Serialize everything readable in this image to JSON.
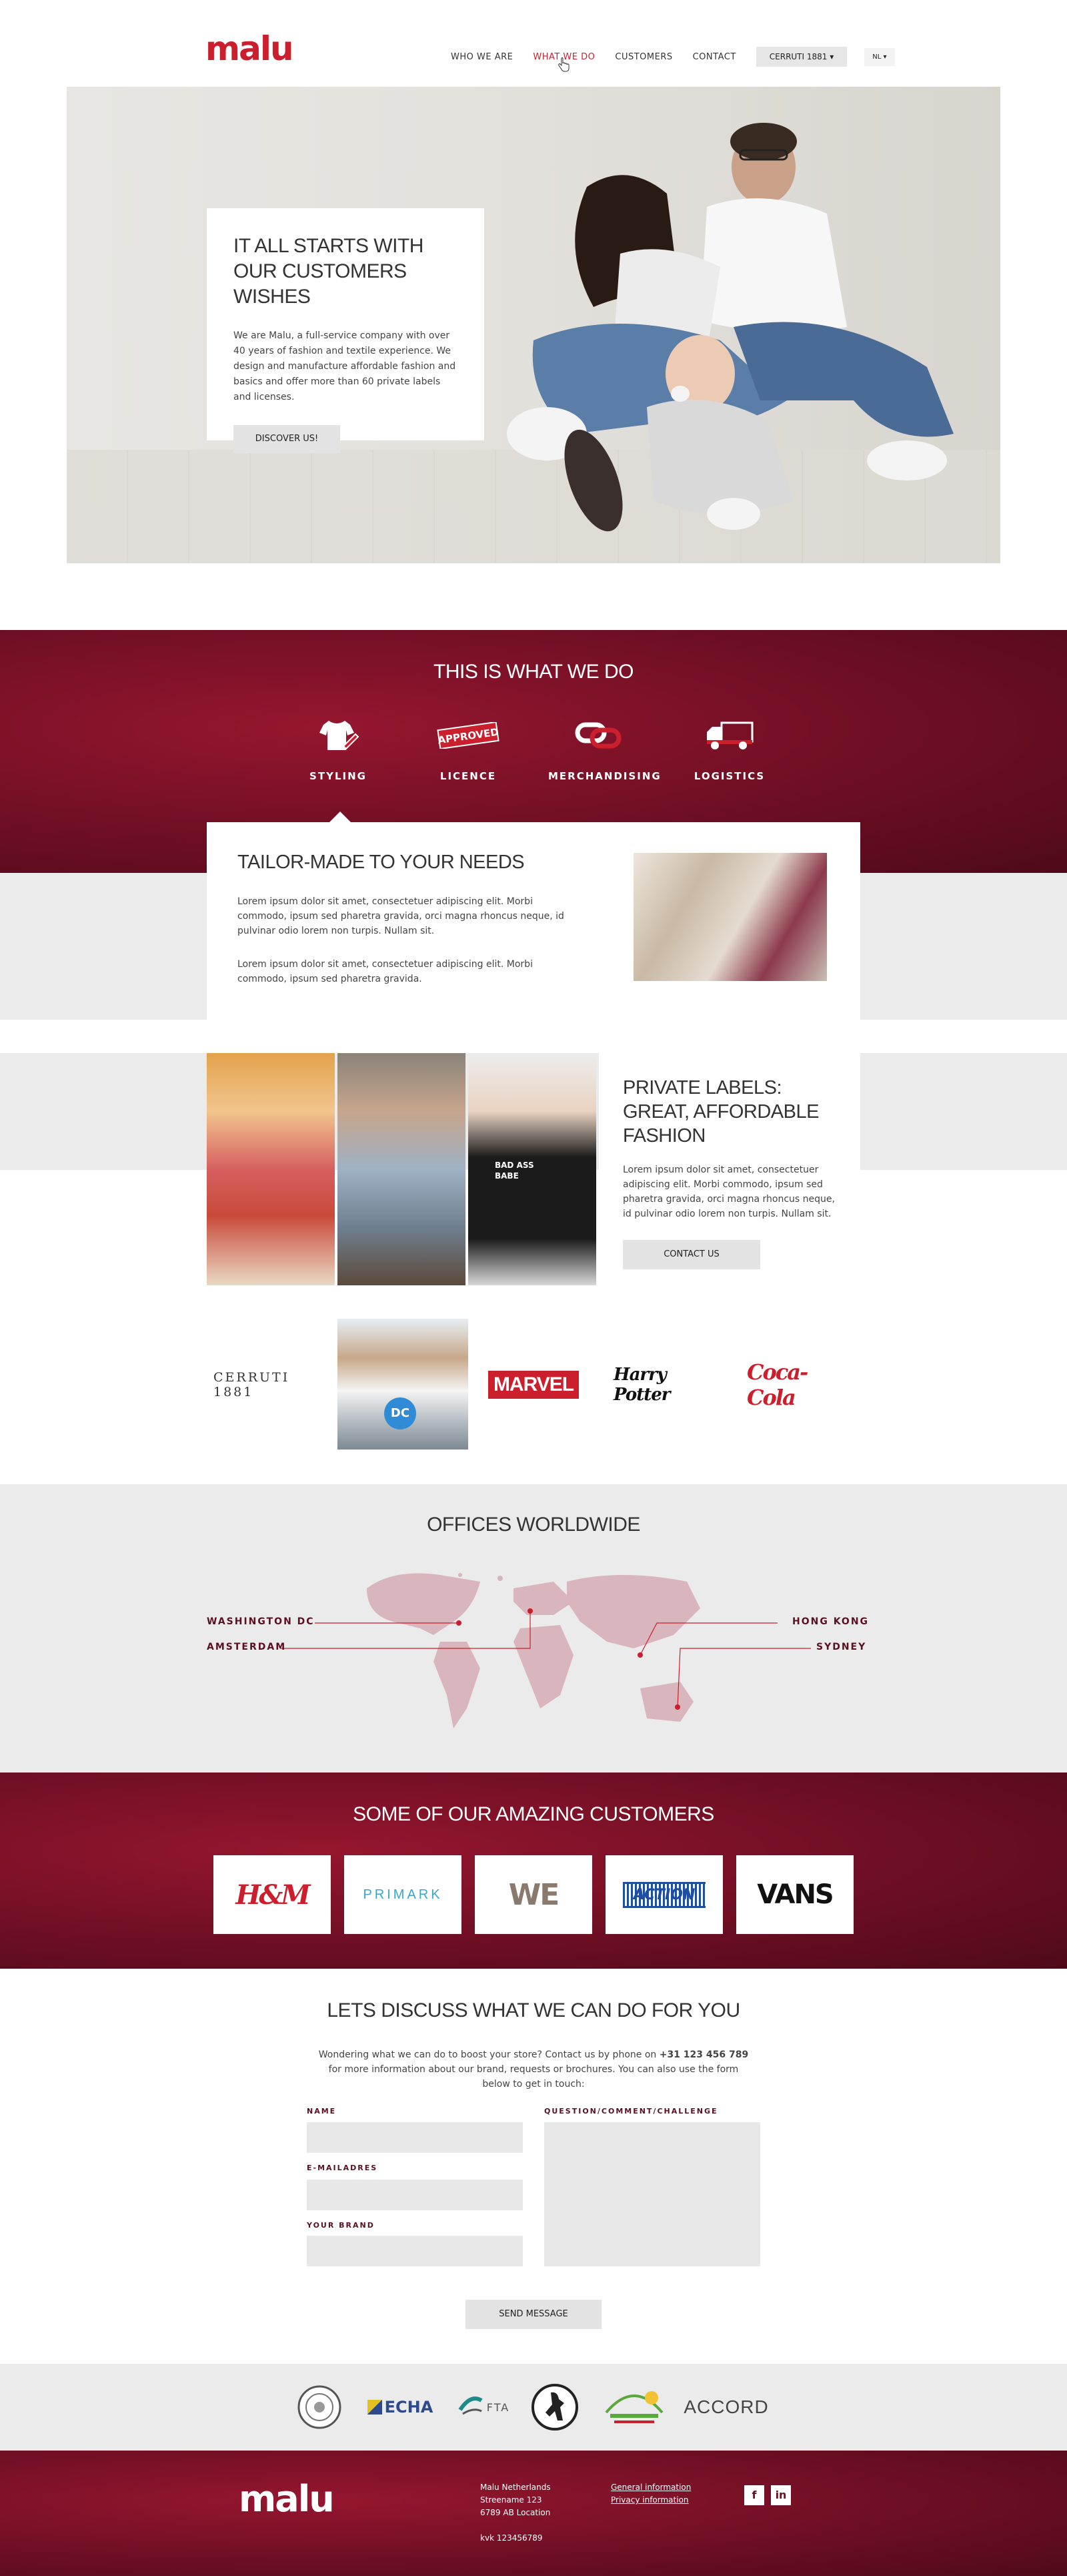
{
  "header": {
    "logo": "malu",
    "nav": [
      {
        "label": "WHO WE ARE",
        "active": false
      },
      {
        "label": "WHAT WE DO",
        "active": true
      },
      {
        "label": "CUSTOMERS",
        "active": false
      },
      {
        "label": "CONTACT",
        "active": false
      }
    ],
    "brand_select": "CERRUTI 1881 ▾",
    "lang_select": "NL ▾"
  },
  "hero": {
    "title": "IT ALL STARTS WITH OUR CUSTOMERS WISHES",
    "text": "We are Malu, a full-service company with over 40 years of fashion and textile experience. We design and manufacture affordable fashion and basics and offer more than 60 private labels and licenses.",
    "button": "DISCOVER US!"
  },
  "what_we_do": {
    "title": "THIS IS WHAT WE DO",
    "services": [
      {
        "label": "STYLING",
        "icon": "tshirt-pencil-icon"
      },
      {
        "label": "LICENCE",
        "icon": "approved-stamp-icon"
      },
      {
        "label": "MERCHANDISING",
        "icon": "chain-link-icon"
      },
      {
        "label": "LOGISTICS",
        "icon": "truck-icon"
      }
    ],
    "approved_text": "APPROVED",
    "tailor": {
      "title": "TAILOR-MADE TO YOUR NEEDS",
      "paragraph1": "Lorem ipsum dolor sit amet, consectetuer adipiscing elit. Morbi commodo, ipsum sed pharetra gravida, orci magna rhoncus neque, id pulvinar odio lorem non turpis. Nullam sit.",
      "paragraph2": "Lorem ipsum dolor sit amet, consectetuer adipiscing elit. Morbi commodo, ipsum sed pharetra gravida."
    }
  },
  "private_labels": {
    "title": "PRIVATE LABELS: GREAT, AFFORDABLE FASHION",
    "text": "Lorem ipsum dolor sit amet, consectetuer adipiscing elit. Morbi commodo, ipsum sed pharetra gravida, orci magna rhoncus neque, id pulvinar odio lorem non turpis. Nullam sit.",
    "button": "CONTACT US",
    "shirt_text": "BAD ASS BABE"
  },
  "brands": {
    "cerruti": "CERRUTI  1881",
    "dc": "DC",
    "marvel": "MARVEL",
    "harry_potter": "Harry Potter",
    "coca_cola": "Coca-Cola"
  },
  "offices": {
    "title": "OFFICES WORLDWIDE",
    "cities": {
      "washington": "WASHINGTON DC",
      "amsterdam": "AMSTERDAM",
      "hong_kong": "HONG KONG",
      "sydney": "SYDNEY"
    }
  },
  "customers": {
    "title": "SOME OF OUR AMAZING CUSTOMERS",
    "logos": [
      "H&M",
      "PRIMARK",
      "WE",
      "ACTION",
      "VANS"
    ]
  },
  "contact": {
    "title": "LETS DISCUSS WHAT WE CAN DO FOR YOU",
    "text_before": "Wondering what we can do to boost your store? Contact us by phone on ",
    "phone": "+31 123 456 789",
    "text_after": " for more information about our brand, requests or brochures. You can also use the form below to get in touch:",
    "fields": {
      "name": "NAME",
      "email": "E-MAILADRES",
      "brand": "YOUR BRAND",
      "question": "QUESTION/COMMENT/CHALLENGE"
    },
    "send": "SEND MESSAGE"
  },
  "certifications": [
    "ECHA",
    "FTA",
    "ACCORD"
  ],
  "footer": {
    "logo": "malu",
    "address": [
      "Malu Netherlands",
      "Streename 123",
      "6789 AB Location"
    ],
    "kvk": "kvk 123456789",
    "links": [
      "General information",
      "Privacy information"
    ],
    "social": [
      "f",
      "in"
    ]
  },
  "colors": {
    "brand_red": "#cc1f2d",
    "dark_red": "#6b0e22",
    "light_grey": "#ebebeb"
  }
}
